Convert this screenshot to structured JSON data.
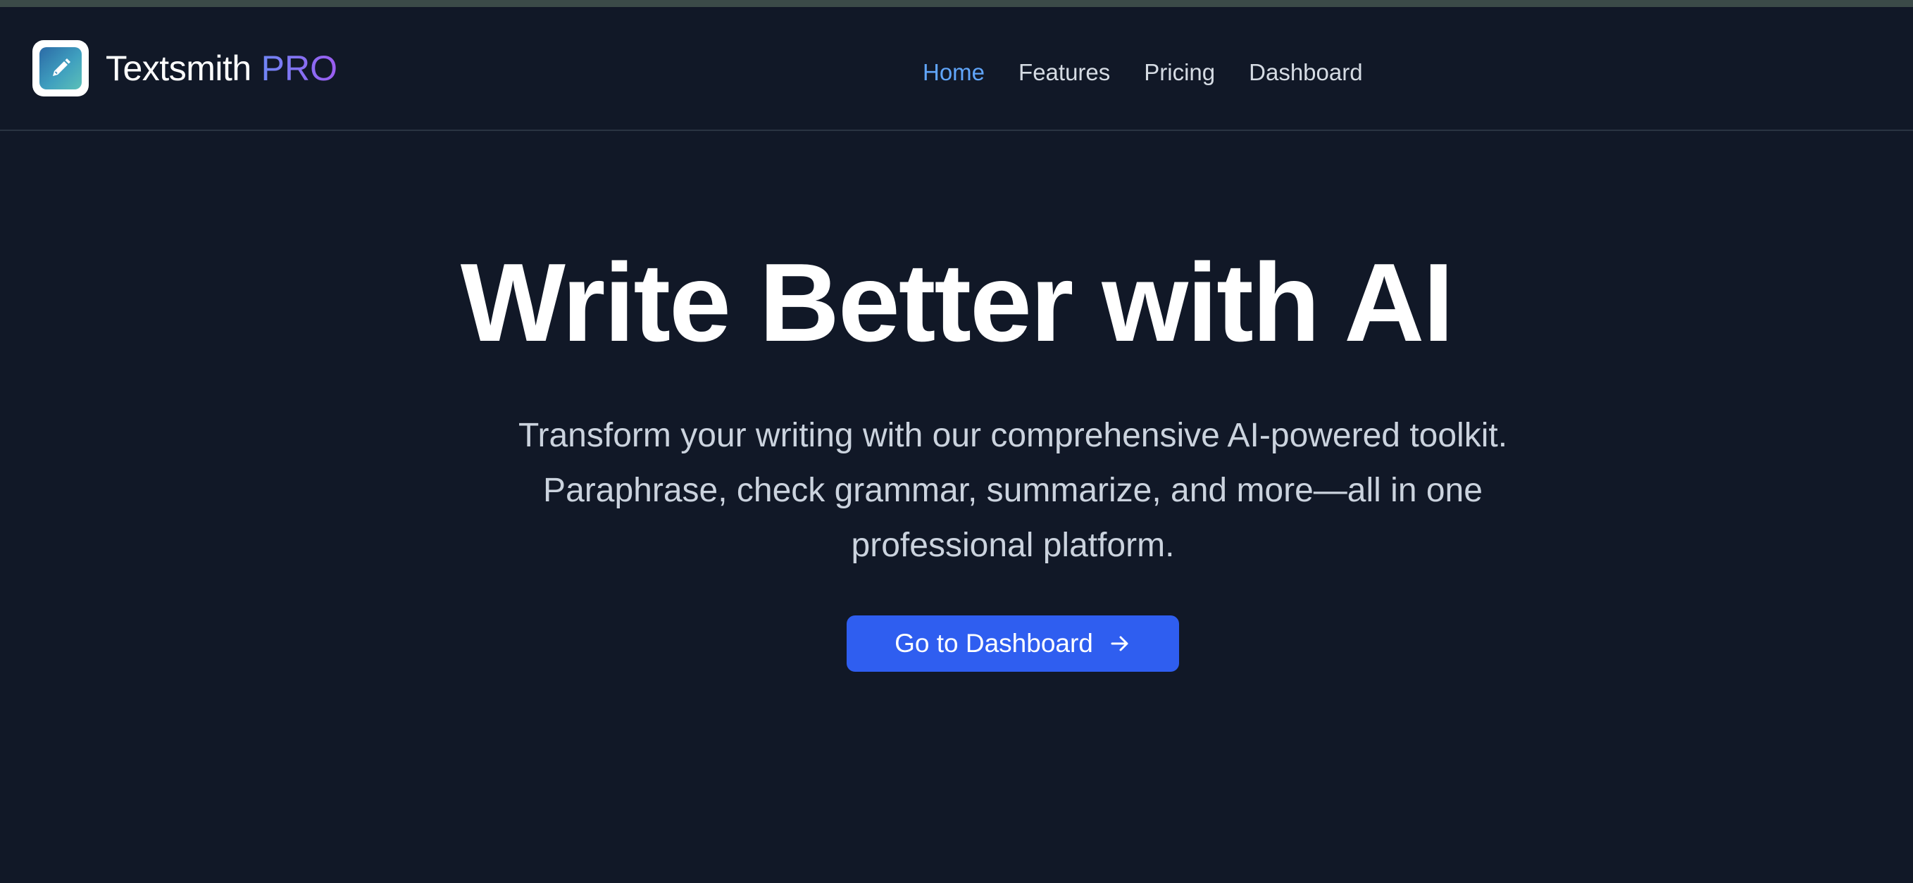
{
  "brand": {
    "name": "Textsmith",
    "suffix": "PRO",
    "logo_icon": "pencil-icon"
  },
  "nav": {
    "items": [
      {
        "label": "Home",
        "active": true
      },
      {
        "label": "Features",
        "active": false
      },
      {
        "label": "Pricing",
        "active": false
      },
      {
        "label": "Dashboard",
        "active": false
      }
    ]
  },
  "hero": {
    "title": "Write Better with AI",
    "subtitle": "Transform your writing with our comprehensive AI-powered toolkit. Paraphrase, check grammar, summarize, and more—all in one professional platform.",
    "cta_label": "Go to Dashboard",
    "cta_icon": "arrow-right-icon"
  },
  "colors": {
    "background": "#111827",
    "accent": "#2f5ef0",
    "active_link": "#60a5fa"
  }
}
